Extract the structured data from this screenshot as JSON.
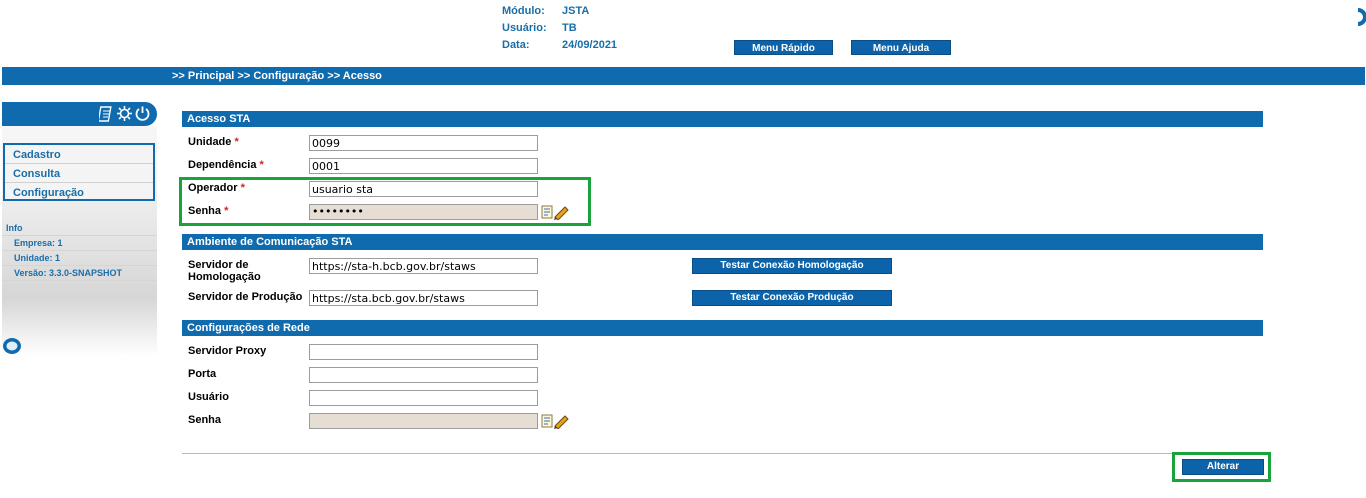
{
  "header": {
    "modulo_label": "Módulo:",
    "modulo_value": "JSTA",
    "usuario_label": "Usuário:",
    "usuario_value": "TB",
    "data_label": "Data:",
    "data_value": "24/09/2021",
    "menu_rapido": "Menu Rápido",
    "menu_ajuda": "Menu Ajuda"
  },
  "breadcrumb": ">> Principal >> Configuração >> Acesso",
  "sidebar": {
    "items": [
      {
        "label": "Cadastro"
      },
      {
        "label": "Consulta"
      },
      {
        "label": "Configuração"
      }
    ],
    "info_title": "Info",
    "info_lines": [
      "Empresa: 1",
      "Unidade: 1",
      "Versão: 3.3.0-SNAPSHOT"
    ]
  },
  "sections": {
    "acesso": {
      "title": "Acesso STA",
      "unidade_label": "Unidade",
      "unidade_value": "0099",
      "dependencia_label": "Dependência",
      "dependencia_value": "0001",
      "operador_label": "Operador",
      "operador_value": "usuario sta",
      "senha_label": "Senha",
      "senha_value": "••••••••",
      "required_mark": "*"
    },
    "ambiente": {
      "title": "Ambiente de Comunicação STA",
      "homolog_label_1": "Servidor de",
      "homolog_label_2": "Homologação",
      "homolog_value": "https://sta-h.bcb.gov.br/staws",
      "producao_label": "Servidor de Produção",
      "producao_value": "https://sta.bcb.gov.br/staws",
      "btn_homolog": "Testar Conexão Homologação",
      "btn_producao": "Testar Conexão Produção"
    },
    "rede": {
      "title": "Configurações de Rede",
      "proxy_label": "Servidor Proxy",
      "porta_label": "Porta",
      "usuario_label": "Usuário",
      "senha_label": "Senha",
      "proxy_value": "",
      "porta_value": "",
      "usuario_value": "",
      "senha_value": ""
    }
  },
  "actions": {
    "alterar": "Alterar"
  },
  "colors": {
    "primary": "#0f6aae",
    "highlight": "#1aa33a",
    "required": "#d61f1f"
  }
}
